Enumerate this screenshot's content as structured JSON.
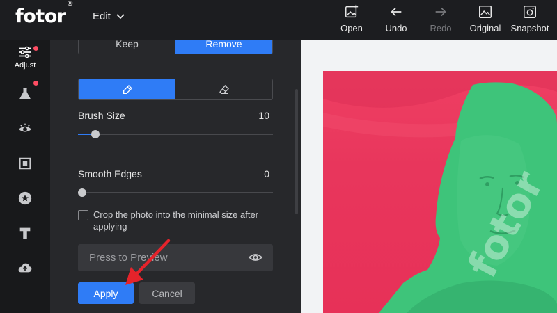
{
  "header": {
    "logo": "fotor",
    "logo_mark": "®",
    "edit_menu": "Edit",
    "tools": [
      {
        "label": "Open",
        "icon": "image-plus-icon",
        "disabled": false
      },
      {
        "label": "Undo",
        "icon": "arrow-left-icon",
        "disabled": false
      },
      {
        "label": "Redo",
        "icon": "arrow-right-icon",
        "disabled": true
      },
      {
        "label": "Original",
        "icon": "image-icon",
        "disabled": false
      },
      {
        "label": "Snapshot",
        "icon": "camera-icon",
        "disabled": false
      }
    ]
  },
  "sidebar": {
    "items": [
      {
        "label": "Adjust",
        "icon": "sliders-icon",
        "badge": true
      },
      {
        "label": "",
        "icon": "flask-icon",
        "badge": true
      },
      {
        "label": "",
        "icon": "eye-icon",
        "badge": false
      },
      {
        "label": "",
        "icon": "frame-icon",
        "badge": false
      },
      {
        "label": "",
        "icon": "star-icon",
        "badge": false
      },
      {
        "label": "",
        "icon": "text-icon",
        "badge": false
      },
      {
        "label": "",
        "icon": "cloud-upload-icon",
        "badge": false
      }
    ]
  },
  "panel": {
    "mode": {
      "keep": "Keep",
      "remove": "Remove",
      "selected": "Remove"
    },
    "tool_select": {
      "brush_icon": "brush-icon",
      "eraser_icon": "eraser-icon",
      "selected": "brush"
    },
    "brush_size": {
      "label": "Brush Size",
      "value": "10",
      "level": 0.09
    },
    "smooth_edges": {
      "label": "Smooth Edges",
      "value": "0",
      "level": 0.0
    },
    "crop_option": {
      "text": "Crop the photo into the minimal size after applying",
      "checked": false
    },
    "preview": {
      "text": "Press to Preview",
      "icon": "eye-icon"
    },
    "apply_label": "Apply",
    "cancel_label": "Cancel"
  },
  "canvas": {
    "watermark": "fotor",
    "colors": {
      "background": "#e8365c",
      "mask": "#3ec47a",
      "accent": "#2f7cf6"
    }
  }
}
